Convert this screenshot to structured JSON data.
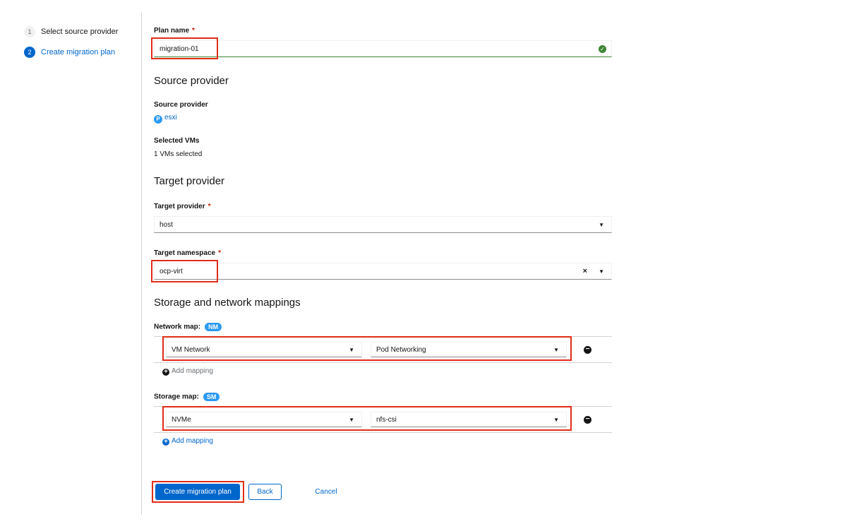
{
  "wizard": {
    "steps": [
      {
        "number": "1",
        "label": "Select source provider"
      },
      {
        "number": "2",
        "label": "Create migration plan"
      }
    ]
  },
  "plan_name": {
    "label": "Plan name",
    "required_mark": "*",
    "value": "migration-01",
    "status_icon": "check-circle-icon"
  },
  "source_provider": {
    "heading": "Source provider",
    "provider_label": "Source provider",
    "provider_icon_letter": "P",
    "provider_name": "esxi",
    "vms_label": "Selected VMs",
    "vms_value": "1 VMs selected"
  },
  "target_provider": {
    "heading": "Target provider",
    "provider_label": "Target provider",
    "required_mark": "*",
    "provider_value": "host",
    "namespace_label": "Target namespace",
    "namespace_value": "ocp-virt",
    "clear_glyph": "×"
  },
  "mappings": {
    "heading": "Storage and network mappings",
    "network": {
      "label": "Network map:",
      "badge": "NM",
      "rows": [
        {
          "source": "VM Network",
          "target": "Pod Networking"
        }
      ],
      "add_label": "Add mapping"
    },
    "storage": {
      "label": "Storage map:",
      "badge": "SM",
      "rows": [
        {
          "source": "NVMe",
          "target": "nfs-csi"
        }
      ],
      "add_label": "Add mapping"
    }
  },
  "actions": {
    "create": "Create migration plan",
    "back": "Back",
    "cancel": "Cancel"
  },
  "colors": {
    "primary": "#0066cc",
    "success": "#3e8635",
    "required": "#c9190b",
    "highlight": "#e02d18",
    "badge": "#2b9af3"
  }
}
